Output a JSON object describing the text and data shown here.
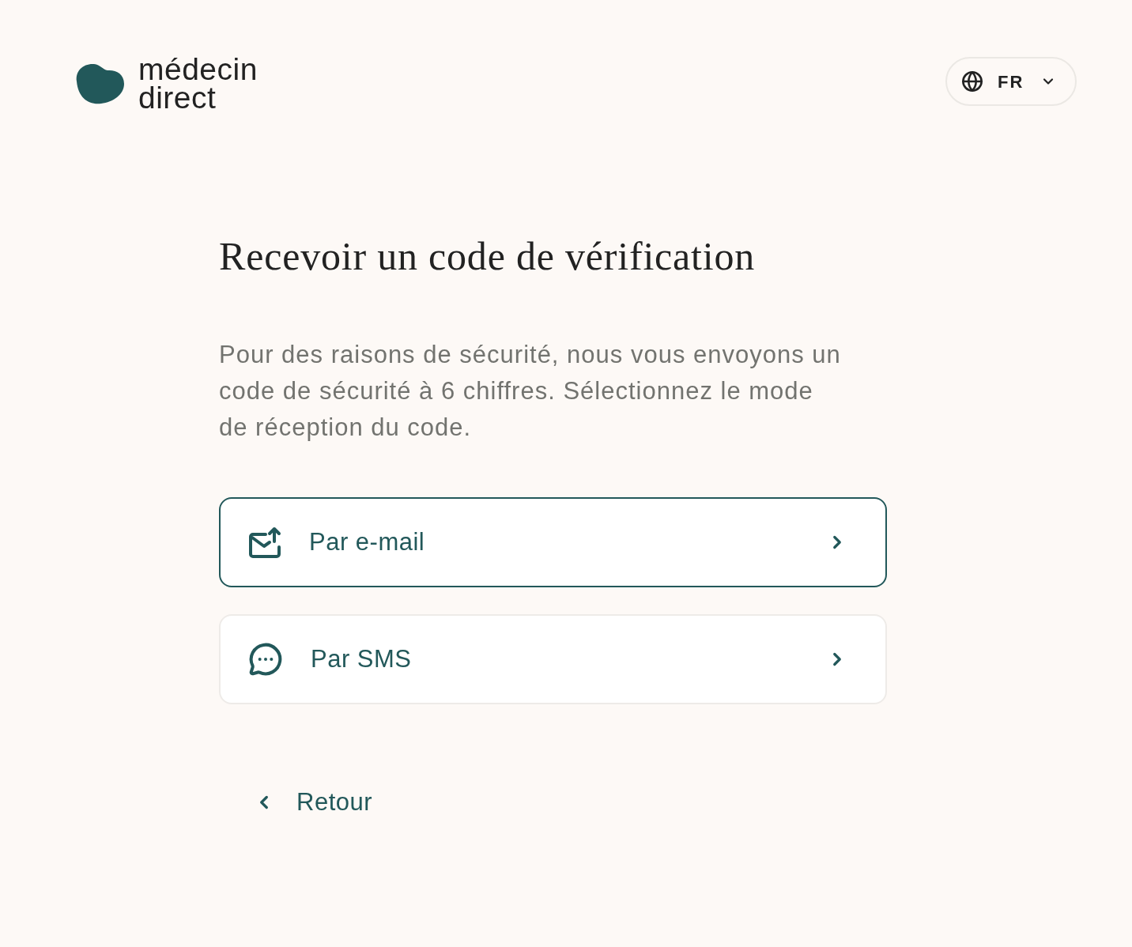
{
  "header": {
    "logo": {
      "lines": [
        "médecin",
        "direct"
      ]
    },
    "language": {
      "code": "FR"
    }
  },
  "title": "Recevoir un code de vérification",
  "description": "Pour des raisons de sécurité, nous vous envoyons un code de sécurité à 6 chiffres. Sélectionnez le mode de réception du code.",
  "options": [
    {
      "kind": "email",
      "label": "Par e-mail",
      "selected": true
    },
    {
      "kind": "sms",
      "label": "Par SMS",
      "selected": false
    }
  ],
  "back": {
    "label": "Retour"
  }
}
